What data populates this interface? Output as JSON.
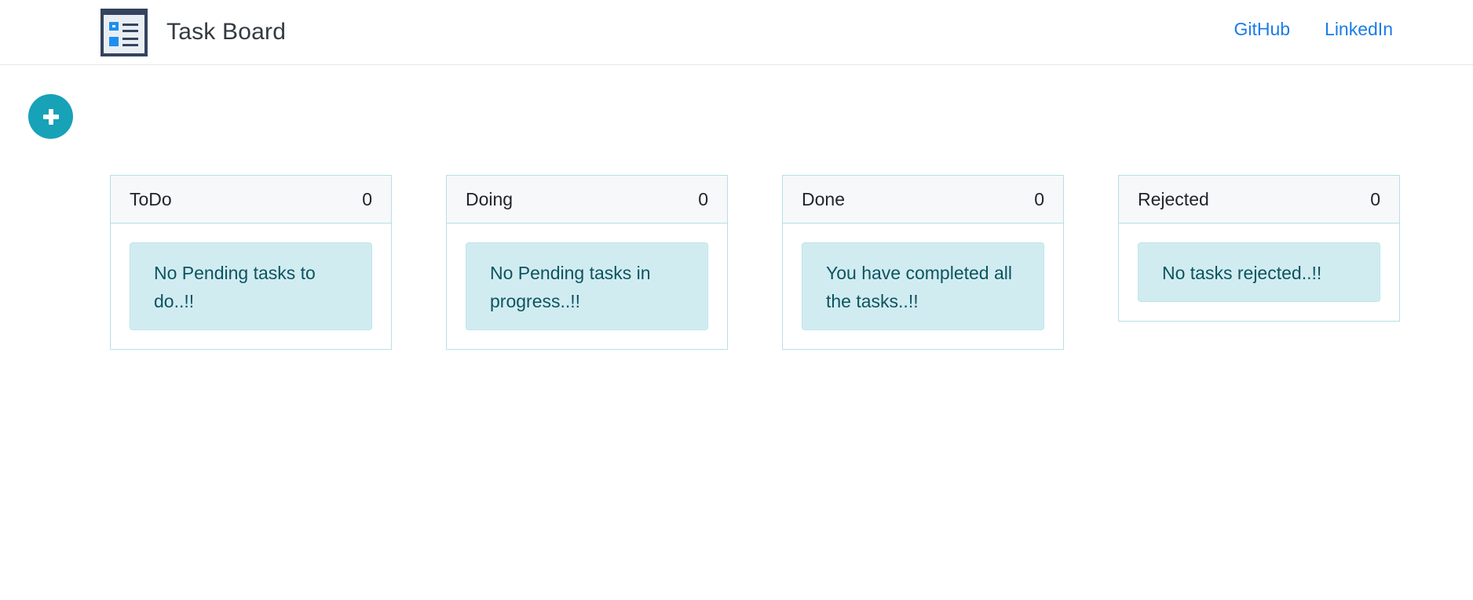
{
  "header": {
    "logo_icon": "task-board-logo-icon",
    "title": "Task Board",
    "links": [
      {
        "label": "GitHub"
      },
      {
        "label": "LinkedIn"
      }
    ]
  },
  "add_button": {
    "icon": "plus-icon",
    "color": "#17a2b8"
  },
  "columns": [
    {
      "title": "ToDo",
      "count": "0",
      "message": "No Pending tasks to do..!!"
    },
    {
      "title": "Doing",
      "count": "0",
      "message": "No Pending tasks in progress..!!"
    },
    {
      "title": "Done",
      "count": "0",
      "message": "You have completed all the tasks..!!"
    },
    {
      "title": "Rejected",
      "count": "0",
      "message": "No tasks rejected..!!"
    }
  ],
  "colors": {
    "accent": "#17a2b8",
    "link": "#1a7ce8",
    "info_bg": "#d1ecf1",
    "info_text": "#0c5460"
  }
}
